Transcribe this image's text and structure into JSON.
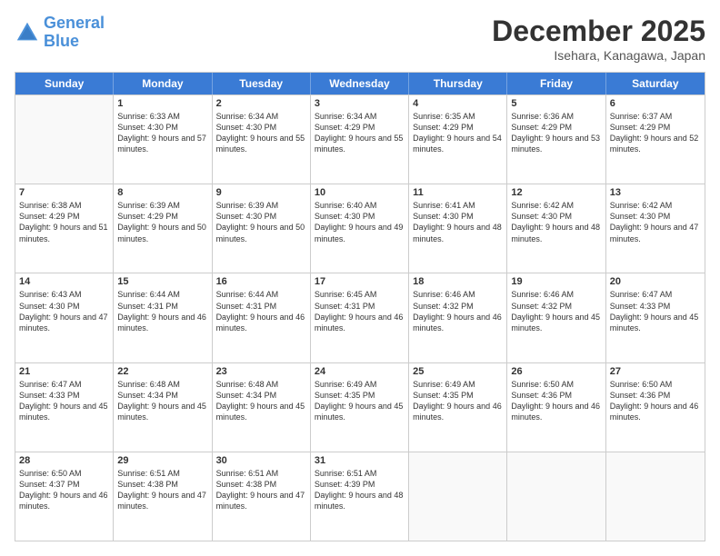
{
  "logo": {
    "line1": "General",
    "line2": "Blue"
  },
  "title": "December 2025",
  "location": "Isehara, Kanagawa, Japan",
  "weekdays": [
    "Sunday",
    "Monday",
    "Tuesday",
    "Wednesday",
    "Thursday",
    "Friday",
    "Saturday"
  ],
  "weeks": [
    [
      {
        "day": "",
        "empty": true
      },
      {
        "day": "1",
        "sunrise": "6:33 AM",
        "sunset": "4:30 PM",
        "daylight": "9 hours and 57 minutes."
      },
      {
        "day": "2",
        "sunrise": "6:34 AM",
        "sunset": "4:30 PM",
        "daylight": "9 hours and 55 minutes."
      },
      {
        "day": "3",
        "sunrise": "6:34 AM",
        "sunset": "4:29 PM",
        "daylight": "9 hours and 55 minutes."
      },
      {
        "day": "4",
        "sunrise": "6:35 AM",
        "sunset": "4:29 PM",
        "daylight": "9 hours and 54 minutes."
      },
      {
        "day": "5",
        "sunrise": "6:36 AM",
        "sunset": "4:29 PM",
        "daylight": "9 hours and 53 minutes."
      },
      {
        "day": "6",
        "sunrise": "6:37 AM",
        "sunset": "4:29 PM",
        "daylight": "9 hours and 52 minutes."
      }
    ],
    [
      {
        "day": "7",
        "sunrise": "6:38 AM",
        "sunset": "4:29 PM",
        "daylight": "9 hours and 51 minutes."
      },
      {
        "day": "8",
        "sunrise": "6:39 AM",
        "sunset": "4:29 PM",
        "daylight": "9 hours and 50 minutes."
      },
      {
        "day": "9",
        "sunrise": "6:39 AM",
        "sunset": "4:30 PM",
        "daylight": "9 hours and 50 minutes."
      },
      {
        "day": "10",
        "sunrise": "6:40 AM",
        "sunset": "4:30 PM",
        "daylight": "9 hours and 49 minutes."
      },
      {
        "day": "11",
        "sunrise": "6:41 AM",
        "sunset": "4:30 PM",
        "daylight": "9 hours and 48 minutes."
      },
      {
        "day": "12",
        "sunrise": "6:42 AM",
        "sunset": "4:30 PM",
        "daylight": "9 hours and 48 minutes."
      },
      {
        "day": "13",
        "sunrise": "6:42 AM",
        "sunset": "4:30 PM",
        "daylight": "9 hours and 47 minutes."
      }
    ],
    [
      {
        "day": "14",
        "sunrise": "6:43 AM",
        "sunset": "4:30 PM",
        "daylight": "9 hours and 47 minutes."
      },
      {
        "day": "15",
        "sunrise": "6:44 AM",
        "sunset": "4:31 PM",
        "daylight": "9 hours and 46 minutes."
      },
      {
        "day": "16",
        "sunrise": "6:44 AM",
        "sunset": "4:31 PM",
        "daylight": "9 hours and 46 minutes."
      },
      {
        "day": "17",
        "sunrise": "6:45 AM",
        "sunset": "4:31 PM",
        "daylight": "9 hours and 46 minutes."
      },
      {
        "day": "18",
        "sunrise": "6:46 AM",
        "sunset": "4:32 PM",
        "daylight": "9 hours and 46 minutes."
      },
      {
        "day": "19",
        "sunrise": "6:46 AM",
        "sunset": "4:32 PM",
        "daylight": "9 hours and 45 minutes."
      },
      {
        "day": "20",
        "sunrise": "6:47 AM",
        "sunset": "4:33 PM",
        "daylight": "9 hours and 45 minutes."
      }
    ],
    [
      {
        "day": "21",
        "sunrise": "6:47 AM",
        "sunset": "4:33 PM",
        "daylight": "9 hours and 45 minutes."
      },
      {
        "day": "22",
        "sunrise": "6:48 AM",
        "sunset": "4:34 PM",
        "daylight": "9 hours and 45 minutes."
      },
      {
        "day": "23",
        "sunrise": "6:48 AM",
        "sunset": "4:34 PM",
        "daylight": "9 hours and 45 minutes."
      },
      {
        "day": "24",
        "sunrise": "6:49 AM",
        "sunset": "4:35 PM",
        "daylight": "9 hours and 45 minutes."
      },
      {
        "day": "25",
        "sunrise": "6:49 AM",
        "sunset": "4:35 PM",
        "daylight": "9 hours and 46 minutes."
      },
      {
        "day": "26",
        "sunrise": "6:50 AM",
        "sunset": "4:36 PM",
        "daylight": "9 hours and 46 minutes."
      },
      {
        "day": "27",
        "sunrise": "6:50 AM",
        "sunset": "4:36 PM",
        "daylight": "9 hours and 46 minutes."
      }
    ],
    [
      {
        "day": "28",
        "sunrise": "6:50 AM",
        "sunset": "4:37 PM",
        "daylight": "9 hours and 46 minutes."
      },
      {
        "day": "29",
        "sunrise": "6:51 AM",
        "sunset": "4:38 PM",
        "daylight": "9 hours and 47 minutes."
      },
      {
        "day": "30",
        "sunrise": "6:51 AM",
        "sunset": "4:38 PM",
        "daylight": "9 hours and 47 minutes."
      },
      {
        "day": "31",
        "sunrise": "6:51 AM",
        "sunset": "4:39 PM",
        "daylight": "9 hours and 48 minutes."
      },
      {
        "day": "",
        "empty": true
      },
      {
        "day": "",
        "empty": true
      },
      {
        "day": "",
        "empty": true
      }
    ]
  ],
  "labels": {
    "sunrise": "Sunrise:",
    "sunset": "Sunset:",
    "daylight": "Daylight:"
  }
}
